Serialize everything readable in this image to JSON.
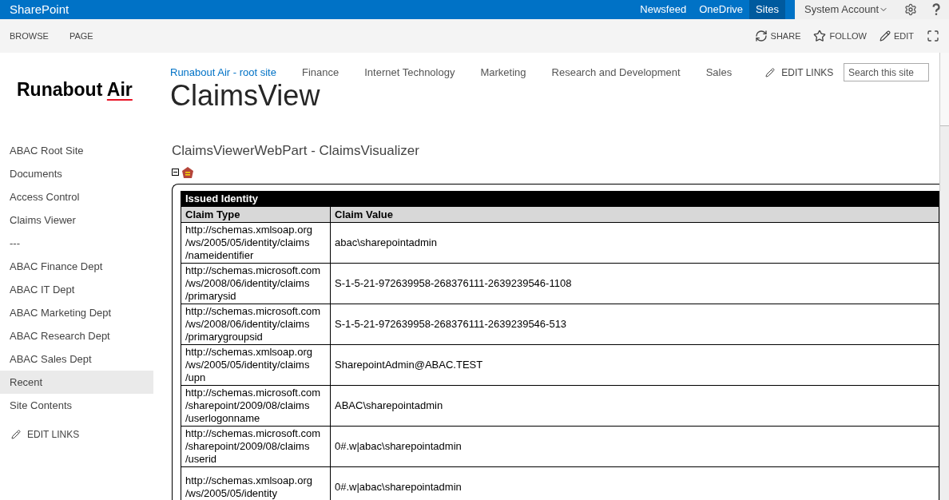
{
  "suite_bar": {
    "brand": "SharePoint",
    "links": [
      {
        "label": "Newsfeed",
        "selected": false
      },
      {
        "label": "OneDrive",
        "selected": false
      },
      {
        "label": "Sites",
        "selected": true
      }
    ],
    "account": "System Account"
  },
  "ribbon": {
    "tabs": [
      "BROWSE",
      "PAGE"
    ],
    "actions": [
      {
        "kind": "share",
        "label": "SHARE"
      },
      {
        "kind": "follow",
        "label": "FOLLOW"
      },
      {
        "kind": "edit",
        "label": "EDIT"
      },
      {
        "kind": "focus"
      }
    ]
  },
  "logo": {
    "text": "Runabout",
    "accent": "Air"
  },
  "top_nav": {
    "items": [
      {
        "label": "Runabout Air - root site",
        "selected": true
      },
      {
        "label": "Finance",
        "selected": false
      },
      {
        "label": "Internet Technology",
        "selected": false
      },
      {
        "label": "Marketing",
        "selected": false
      },
      {
        "label": "Research and Development",
        "selected": false
      },
      {
        "label": "Sales",
        "selected": false
      }
    ],
    "edit_links": "EDIT LINKS",
    "search": {
      "placeholder": "Search this site"
    }
  },
  "page_title": "ClaimsView",
  "quick_launch": {
    "items": [
      {
        "label": "ABAC Root Site",
        "selected": false
      },
      {
        "label": "Documents",
        "selected": false
      },
      {
        "label": "Access Control",
        "selected": false
      },
      {
        "label": "Claims Viewer",
        "selected": false
      },
      {
        "label": "---",
        "selected": false
      },
      {
        "label": "ABAC Finance Dept",
        "selected": false
      },
      {
        "label": "ABAC IT Dept",
        "selected": false
      },
      {
        "label": "ABAC Marketing Dept",
        "selected": false
      },
      {
        "label": "ABAC Research Dept",
        "selected": false
      },
      {
        "label": "ABAC Sales Dept",
        "selected": false
      },
      {
        "label": "Recent",
        "selected": true
      },
      {
        "label": "Site Contents",
        "selected": false
      }
    ],
    "edit_links": "EDIT LINKS"
  },
  "web_part": {
    "title": "ClaimsViewerWebPart - ClaimsVisualizer",
    "expanded": true,
    "table": {
      "caption": "Issued Identity",
      "columns": [
        "Claim Type",
        "Claim Value"
      ],
      "rows": [
        {
          "type": "http://schemas.xmlsoap.org/ws/2005/05/identity/claims/nameidentifier",
          "value": "abac\\sharepointadmin"
        },
        {
          "type": "http://schemas.microsoft.com/ws/2008/06/identity/claims/primarysid",
          "value": "S-1-5-21-972639958-268376111-2639239546-1108"
        },
        {
          "type": "http://schemas.microsoft.com/ws/2008/06/identity/claims/primarygroupsid",
          "value": "S-1-5-21-972639958-268376111-2639239546-513"
        },
        {
          "type": "http://schemas.xmlsoap.org/ws/2005/05/identity/claims/upn",
          "value": "SharepointAdmin@ABAC.TEST"
        },
        {
          "type": "http://schemas.microsoft.com/sharepoint/2009/08/claims/userlogonname",
          "value": "ABAC\\sharepointadmin"
        },
        {
          "type": "http://schemas.microsoft.com/sharepoint/2009/08/claims/userid",
          "value": "0#.w|abac\\sharepointadmin"
        },
        {
          "type": "http://schemas.xmlsoap.org/ws/2005/05/identity",
          "value": "0#.w|abac\\sharepointadmin"
        }
      ]
    }
  }
}
